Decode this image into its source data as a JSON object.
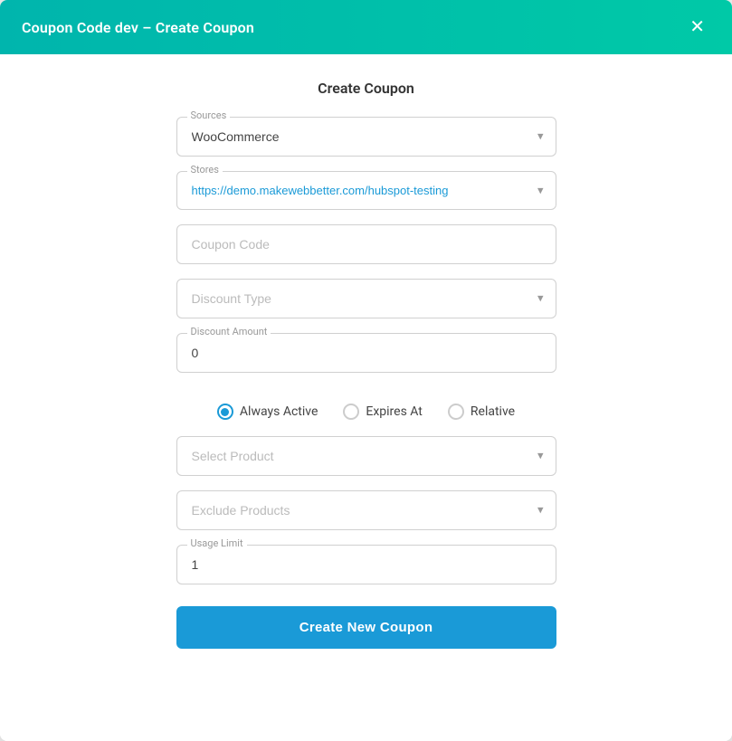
{
  "header": {
    "title": "Coupon Code dev – Create Coupon",
    "close_label": "✕"
  },
  "form": {
    "title": "Create Coupon",
    "sources_label": "Sources",
    "sources_value": "WooCommerce",
    "stores_label": "Stores",
    "stores_value": "https://demo.makewebbetter.com/hubspot-testing",
    "coupon_code_placeholder": "Coupon Code",
    "discount_type_placeholder": "Discount Type",
    "discount_amount_label": "Discount Amount",
    "discount_amount_value": "0",
    "radio_options": [
      {
        "label": "Always Active",
        "selected": true
      },
      {
        "label": "Expires At",
        "selected": false
      },
      {
        "label": "Relative",
        "selected": false
      }
    ],
    "select_product_placeholder": "Select Product",
    "exclude_products_placeholder": "Exclude Products",
    "usage_limit_label": "Usage Limit",
    "usage_limit_value": "1",
    "create_btn_label": "Create New Coupon"
  }
}
